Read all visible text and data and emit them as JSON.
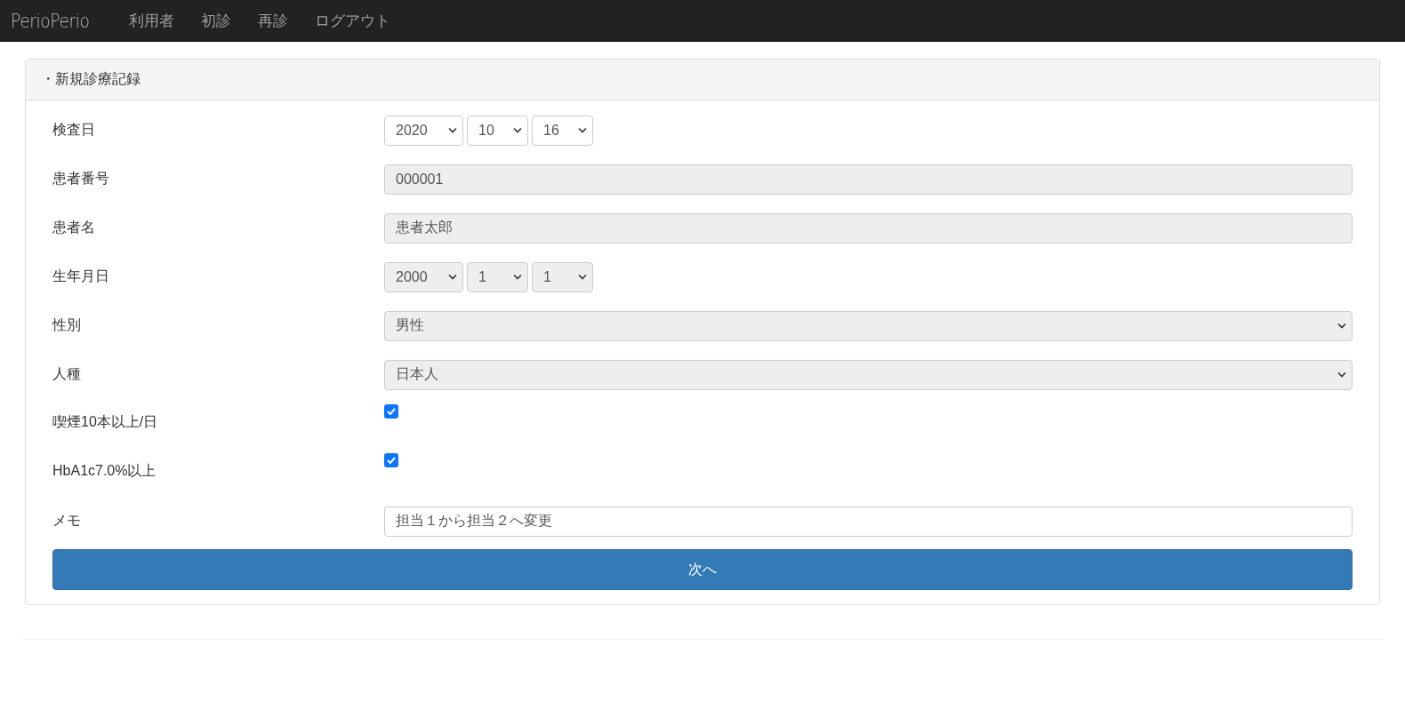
{
  "navbar": {
    "brand": "PerioPerio",
    "links": [
      "利用者",
      "初診",
      "再診",
      "ログアウト"
    ]
  },
  "panel": {
    "title": "・新規診療記録",
    "fields": [
      {
        "label": "検査日",
        "kind": "date",
        "disabled": false,
        "parts": [
          "2020",
          "10",
          "16"
        ]
      },
      {
        "label": "患者番号",
        "kind": "text",
        "disabled": true,
        "value": "000001"
      },
      {
        "label": "患者名",
        "kind": "text",
        "disabled": true,
        "value": "患者太郎"
      },
      {
        "label": "生年月日",
        "kind": "date",
        "disabled": true,
        "parts": [
          "2000",
          "1",
          "1"
        ]
      },
      {
        "label": "性別",
        "kind": "select",
        "disabled": true,
        "value": "男性"
      },
      {
        "label": "人種",
        "kind": "select",
        "disabled": true,
        "value": "日本人"
      },
      {
        "label": "喫煙10本以上/日",
        "kind": "checkbox",
        "checked": true
      },
      {
        "label": "HbA1c7.0%以上",
        "kind": "checkbox",
        "checked": true
      },
      {
        "label": "メモ",
        "kind": "text",
        "disabled": false,
        "value": "担当１から担当２へ変更"
      }
    ],
    "submit": "次へ"
  }
}
